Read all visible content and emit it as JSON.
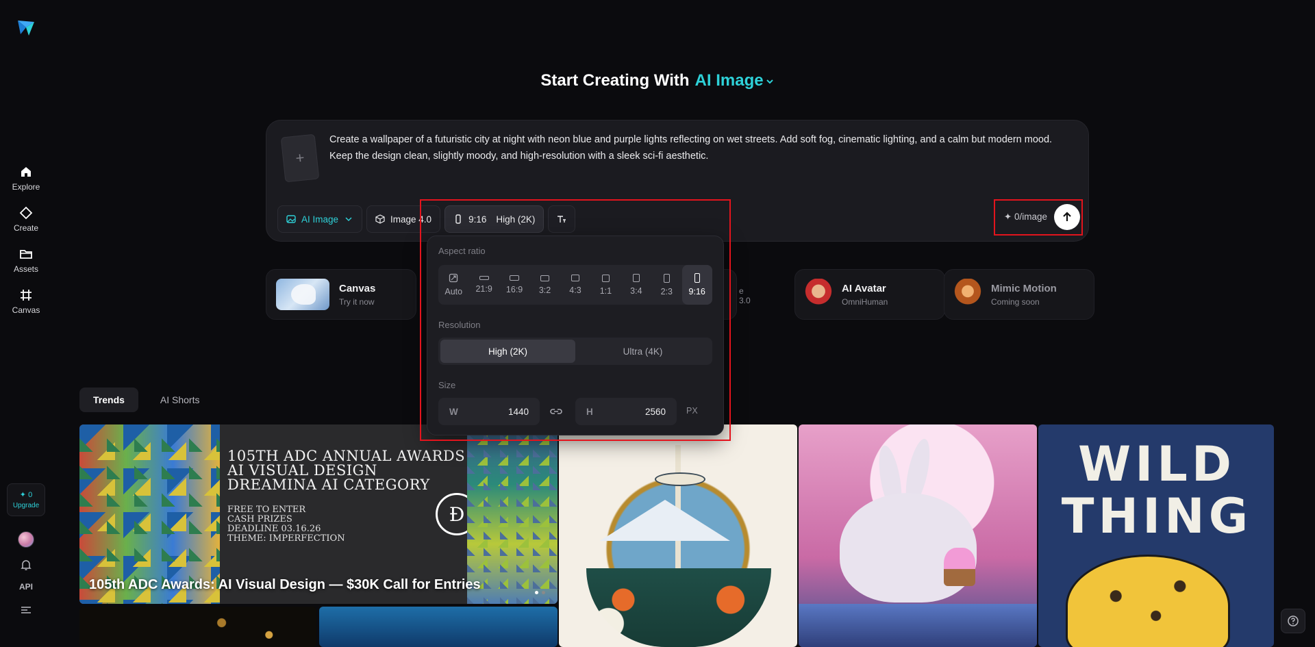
{
  "header": {
    "title_prefix": "Start Creating With",
    "title_mode": "AI Image"
  },
  "sidebar": {
    "items": [
      {
        "label": "Explore",
        "icon": "home-icon"
      },
      {
        "label": "Create",
        "icon": "diamond-icon"
      },
      {
        "label": "Assets",
        "icon": "folder-icon"
      },
      {
        "label": "Canvas",
        "icon": "canvas-icon"
      }
    ],
    "credits": "0",
    "upgrade_label": "Upgrade",
    "api_label": "API"
  },
  "prompt": {
    "text": "Create a wallpaper of a futuristic city at night with neon blue and purple lights reflecting on wet streets. Add soft fog, cinematic lighting, and a calm but modern mood. Keep the design clean, slightly moody, and high-resolution with a sleek sci-fi aesthetic.",
    "add_ref_symbol": "+"
  },
  "toolbar": {
    "mode_label": "AI Image",
    "model_label": "Image 4.0",
    "ratio_label": "9:16",
    "resolution_label": "High (2K)",
    "credit_text": "0/image"
  },
  "panel": {
    "aspect_title": "Aspect ratio",
    "ratios": [
      "Auto",
      "21:9",
      "16:9",
      "3:2",
      "4:3",
      "1:1",
      "3:4",
      "2:3",
      "9:16"
    ],
    "selected_ratio": "9:16",
    "resolution_title": "Resolution",
    "resolutions": [
      "High (2K)",
      "Ultra (4K)"
    ],
    "selected_resolution": "High (2K)",
    "size_title": "Size",
    "width_label": "W",
    "width_value": "1440",
    "height_label": "H",
    "height_value": "2560",
    "unit": "PX"
  },
  "features": [
    {
      "name": "Canvas",
      "sub": "Try it now"
    },
    {
      "name": "",
      "sub": "e 3.0"
    },
    {
      "name": "AI Avatar",
      "sub": "OmniHuman"
    },
    {
      "name": "Mimic Motion",
      "sub": "Coming soon"
    }
  ],
  "tabs": [
    {
      "label": "Trends",
      "active": true
    },
    {
      "label": "AI Shorts",
      "active": false
    }
  ],
  "gallery": {
    "banner_title": "105TH ADC ANNUAL AWARDS\nAI VISUAL DESIGN\nDREAMINA AI CATEGORY",
    "banner_info": "FREE TO ENTER\nCASH PRIZES\nDEADLINE 03.16.26\nTHEME: IMPERFECTION",
    "banner_caption": "105th ADC Awards: AI Visual Design — $30K Call for Entries",
    "wild_text": "WILD THING"
  },
  "colors": {
    "accent": "#2ed1d8",
    "highlight": "#e3141d",
    "background": "#0b0b0e"
  }
}
